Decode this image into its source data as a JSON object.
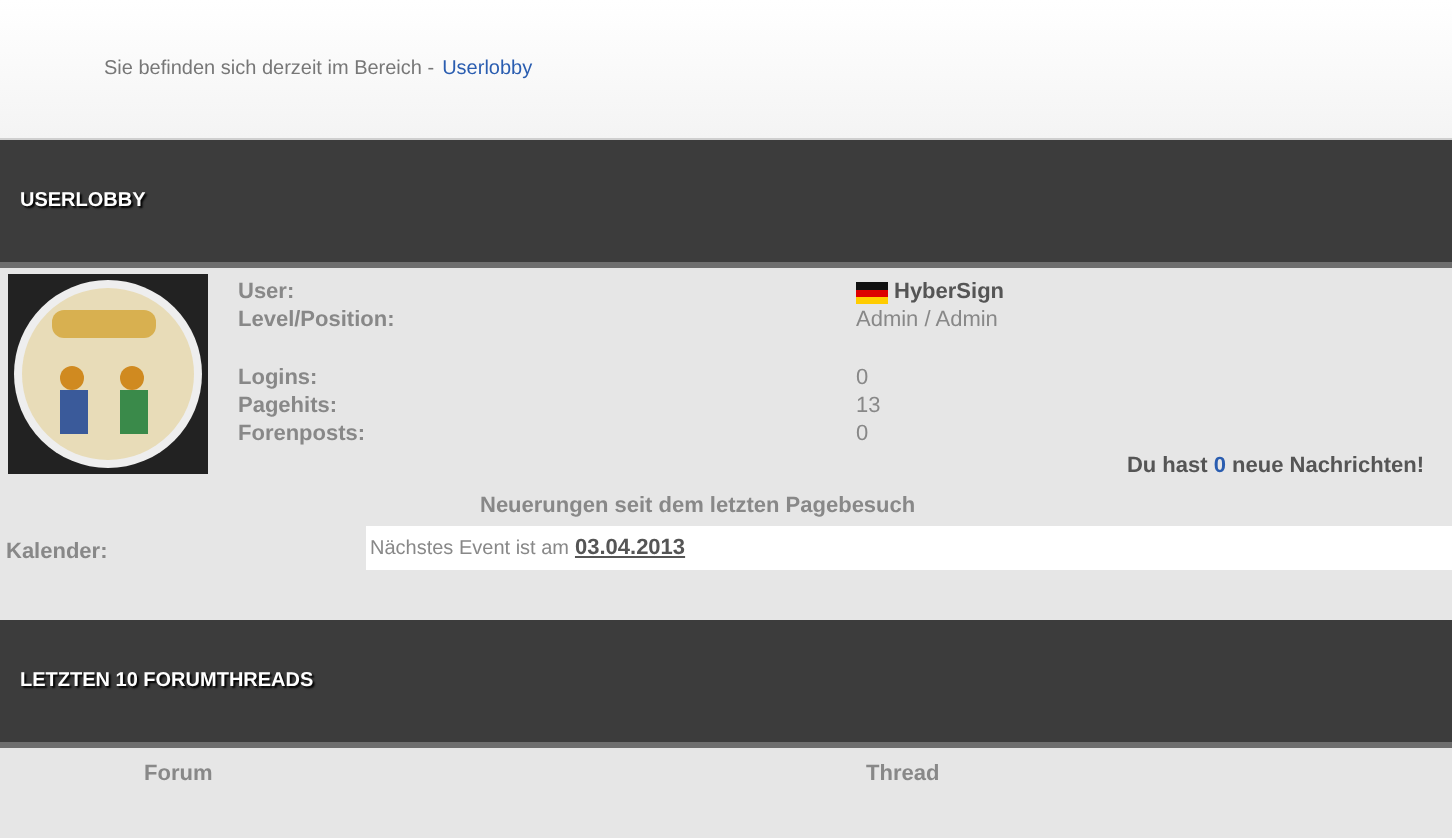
{
  "breadcrumb": {
    "text": "Sie befinden sich derzeit im Bereich -",
    "link": "Userlobby"
  },
  "userlobby": {
    "title": "USERLOBBY",
    "fields": [
      {
        "label": "User:",
        "value": "HyberSign",
        "kind": "user"
      },
      {
        "label": "Level/Position:",
        "value": "Admin / Admin",
        "kind": "plain"
      },
      {
        "label": "Logins:",
        "value": "0",
        "kind": "plain"
      },
      {
        "label": "Pagehits:",
        "value": "13",
        "kind": "plain"
      },
      {
        "label": "Forenposts:",
        "value": "0",
        "kind": "plain"
      }
    ],
    "messages": {
      "before": "Du hast",
      "count": "0",
      "after": "neue Nachrichten!"
    },
    "news": "Neuerungen seit dem letzten Pagebesuch",
    "calendar": {
      "label": "Kalender:",
      "text": "Nächstes Event ist am",
      "date": "03.04.2013"
    }
  },
  "forumthreads": {
    "title": "LETZTEN 10 FORUMTHREADS",
    "columns": [
      "Forum",
      "Thread"
    ]
  }
}
